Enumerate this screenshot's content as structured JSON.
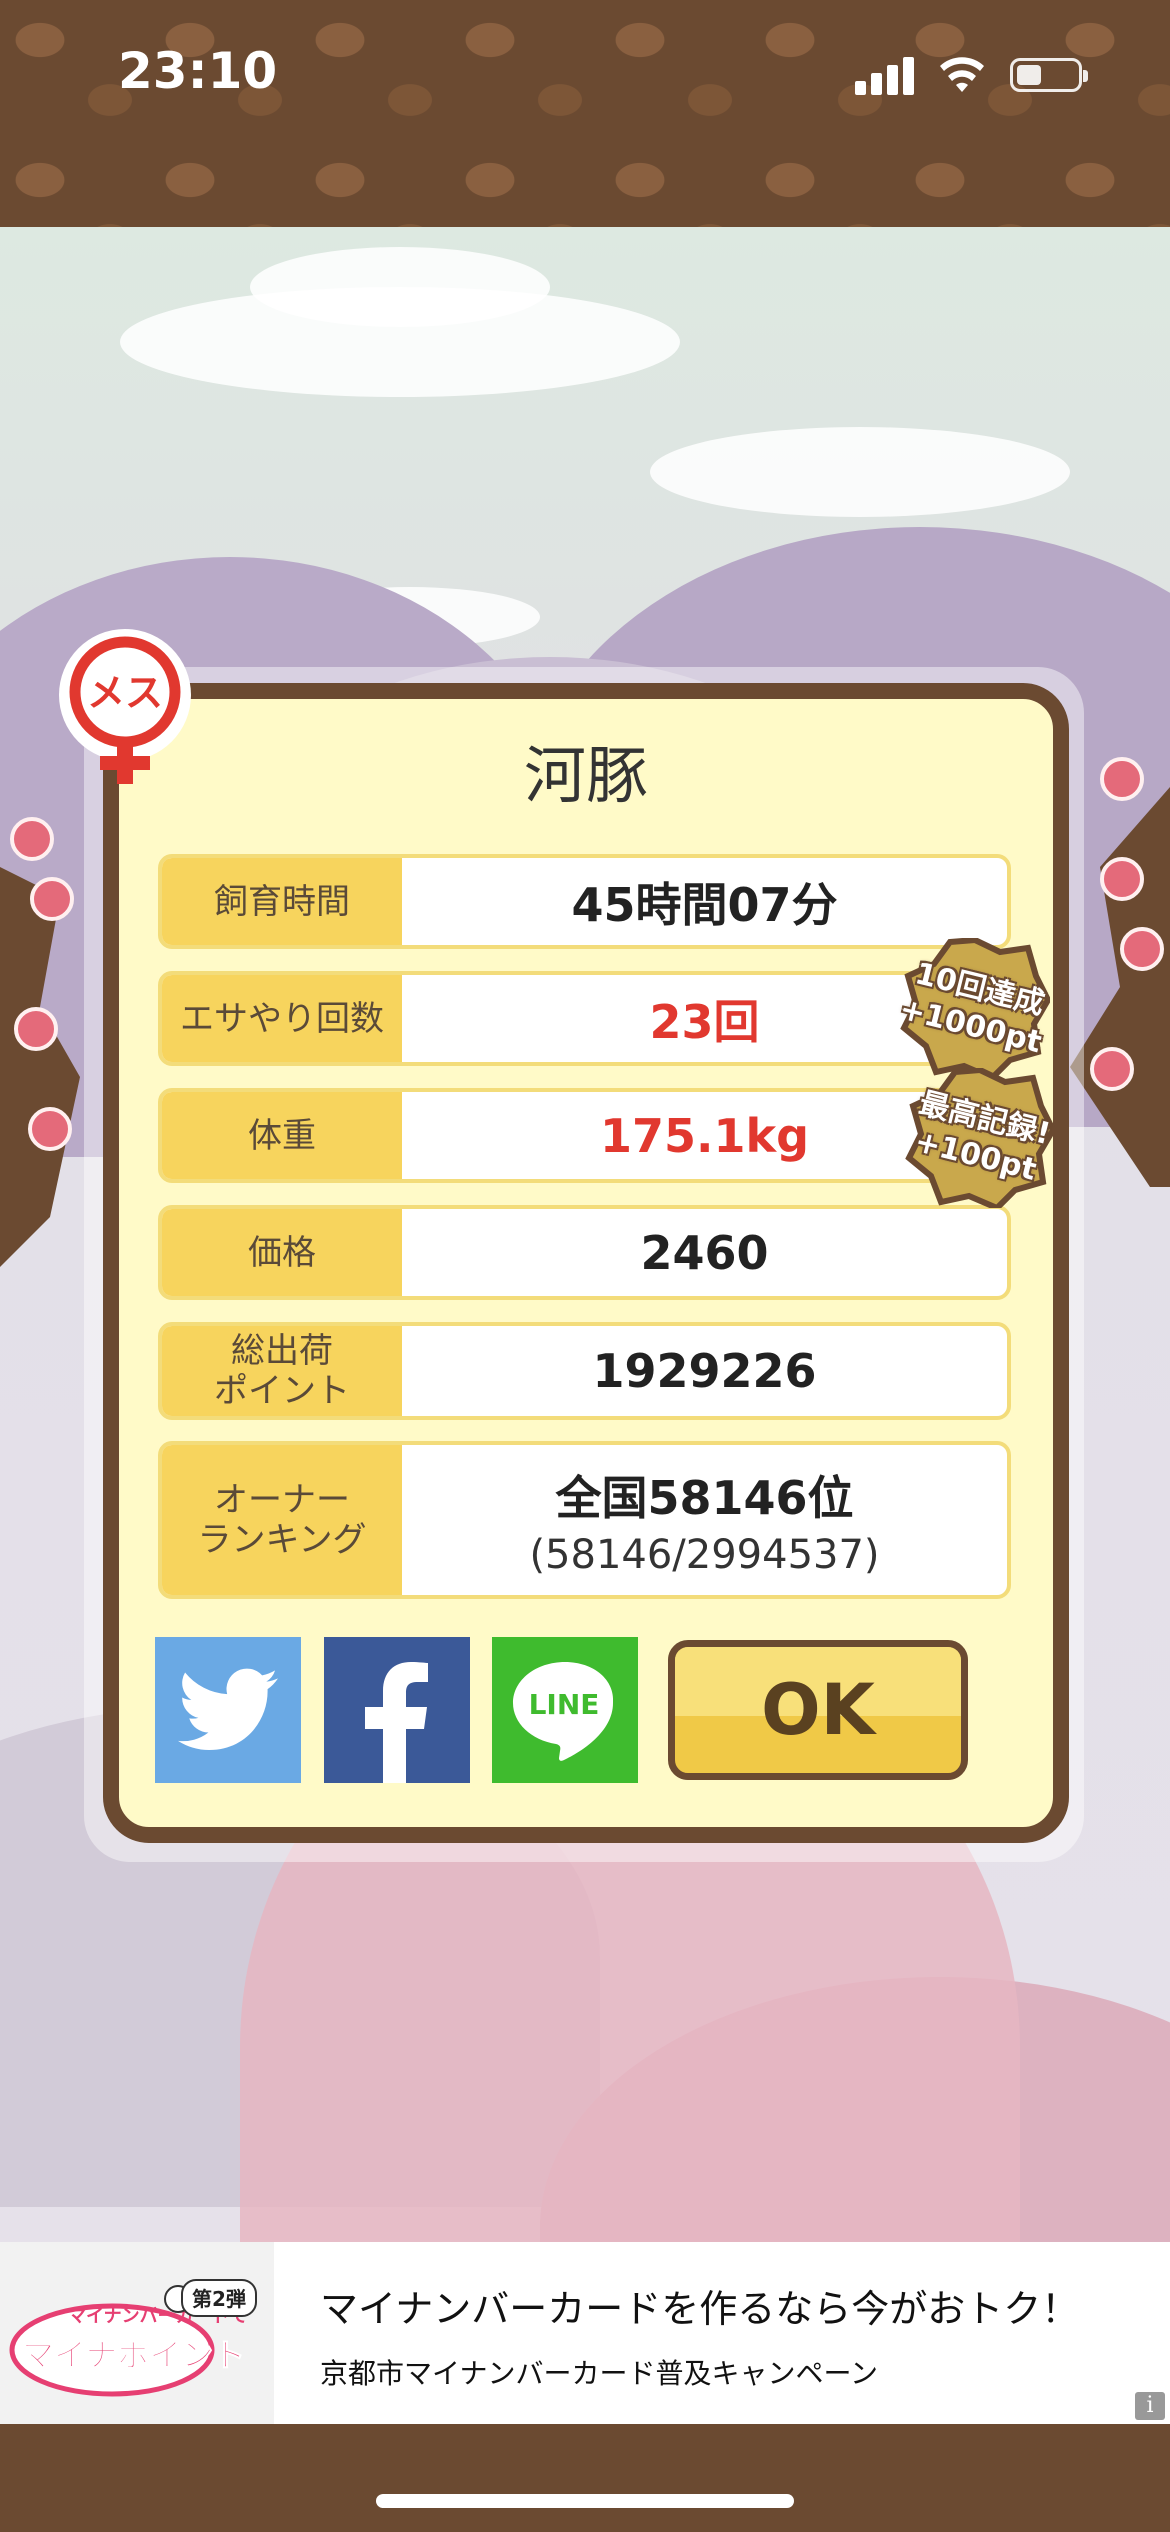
{
  "status_bar": {
    "time": "23:10"
  },
  "dialog": {
    "gender_badge": "メス",
    "title": "河豚",
    "rows": [
      {
        "label": "飼育時間",
        "value": "45時間07分"
      },
      {
        "label": "エサやり回数",
        "value": "23回"
      },
      {
        "label": "体重",
        "value": "175.1kg"
      },
      {
        "label": "価格",
        "value": "2460"
      },
      {
        "label": "総出荷\nポイント",
        "value": "1929226"
      },
      {
        "label": "オーナー\nランキング",
        "value": "全国58146位",
        "sub": "(58146/2994537)"
      }
    ],
    "medals": [
      {
        "line1": "10回達成",
        "line2": "+1000pt"
      },
      {
        "line1": "最高記録!",
        "line2": "+100pt"
      }
    ],
    "share": {
      "line_label": "LINE"
    },
    "ok_label": "OK"
  },
  "ad": {
    "logo_top": "マイナンバーカードで",
    "logo_badge": "第2弾",
    "logo_main": "マイナポイント",
    "headline": "マイナンバーカードを作るなら今がおトク！",
    "subline": "京都市マイナンバーカード普及キャンペーン",
    "info_icon": "i"
  },
  "colors": {
    "brown": "#6b4a31",
    "cream": "#fffac8",
    "label_yellow": "#f7d45d",
    "accent_red": "#e1382f",
    "twitter": "#6aa9e4",
    "facebook": "#3b5998",
    "line": "#3fbb2e"
  }
}
